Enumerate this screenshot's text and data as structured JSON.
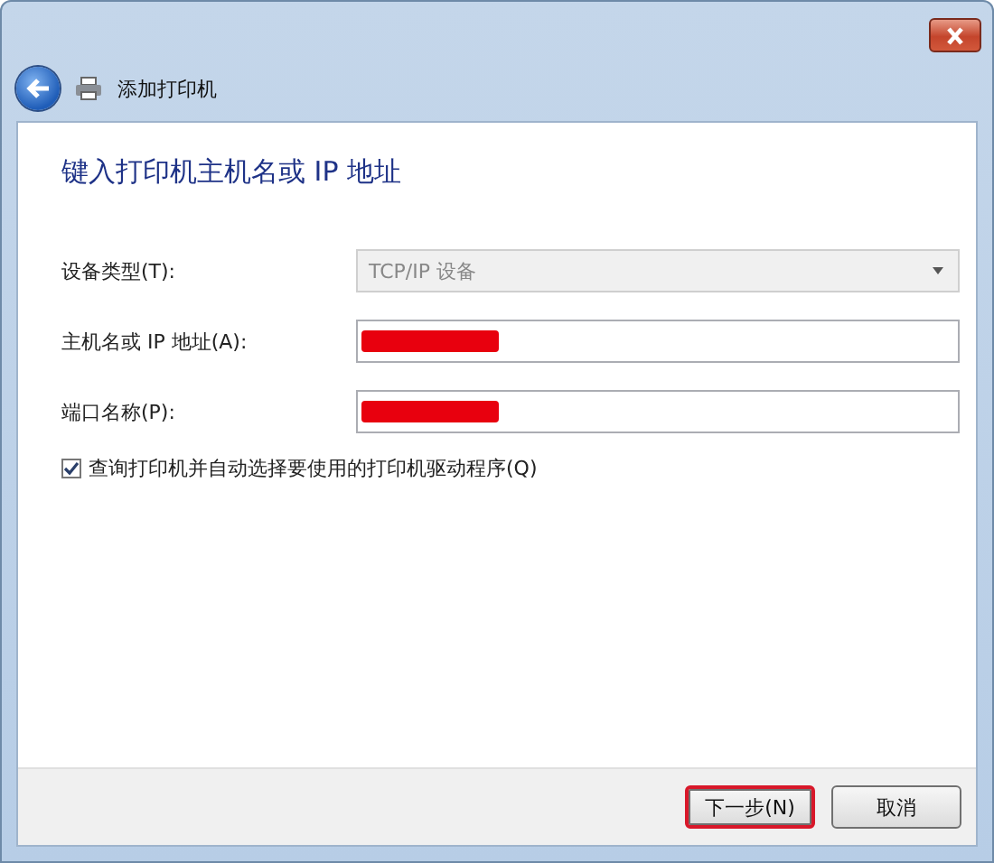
{
  "window": {
    "title": "添加打印机"
  },
  "heading": "键入打印机主机名或 IP 地址",
  "fields": [
    {
      "kind": "dropdown",
      "label": "设备类型(T):",
      "value": "TCP/IP 设备",
      "disabled": true,
      "redacted": false
    },
    {
      "kind": "text",
      "label": "主机名或 IP 地址(A):",
      "redacted": true,
      "disabled": false
    },
    {
      "kind": "text",
      "label": "端口名称(P):",
      "redacted": true,
      "disabled": false
    }
  ],
  "checkbox": {
    "label": "查询打印机并自动选择要使用的打印机驱动程序(Q)",
    "checked": true
  },
  "buttons": [
    {
      "label": "下一步(N)",
      "highlighted": true
    },
    {
      "label": "取消",
      "highlighted": false
    }
  ]
}
